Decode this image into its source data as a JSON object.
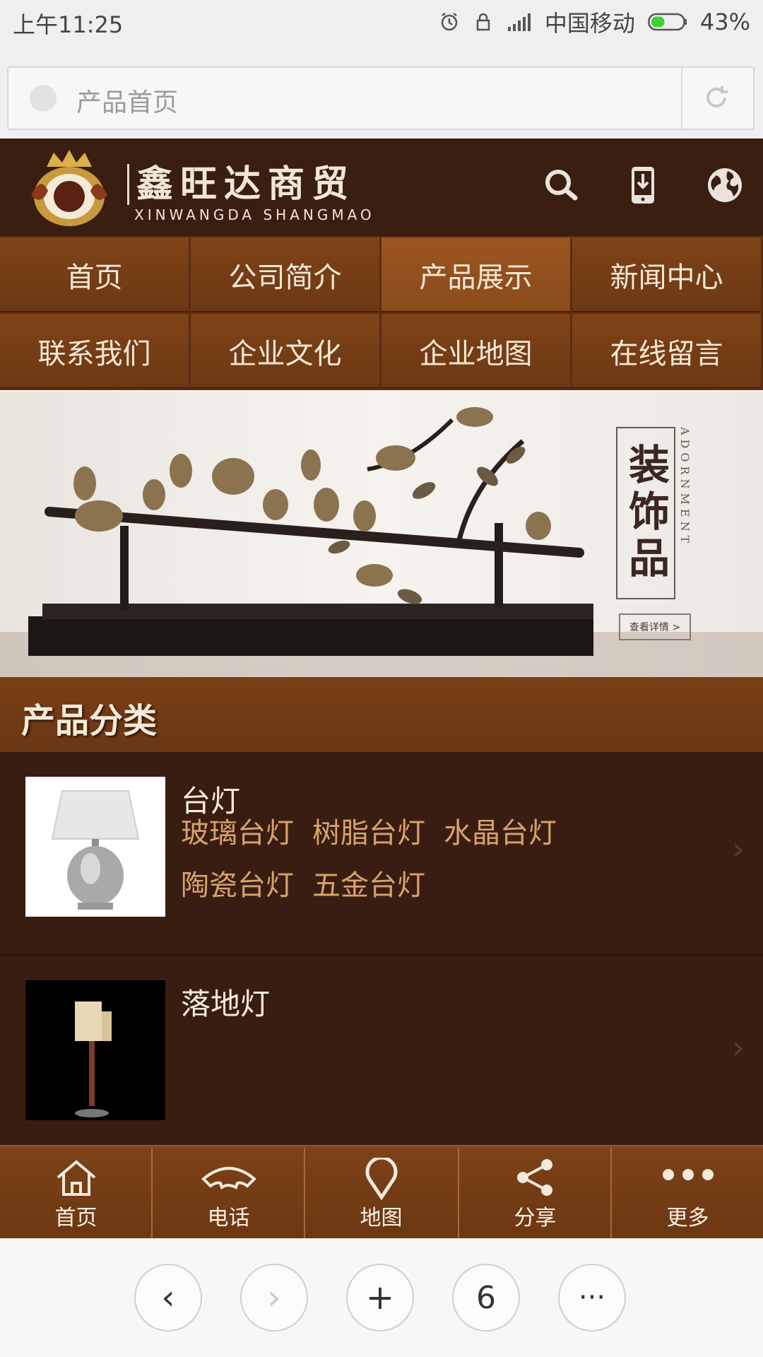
{
  "status_bar": {
    "time": "上午11:25",
    "carrier": "中国移动",
    "battery": "43%",
    "battery_level": 0.43,
    "icons": [
      "alarm-icon",
      "lock-icon",
      "signal-icon",
      "battery-icon"
    ]
  },
  "address_bar": {
    "page_title": "产品首页",
    "icons": [
      "site-globe-icon",
      "reload-icon"
    ]
  },
  "site_header": {
    "brand_cn": "鑫旺达商贸",
    "brand_en": "XINWANGDA SHANGMAO",
    "icons": [
      "search-icon",
      "mobile-download-icon",
      "globe-icon"
    ],
    "colors": {
      "header_bg": "#3a1e12",
      "accent": "#7f4318"
    }
  },
  "nav": {
    "items": [
      {
        "label": "首页"
      },
      {
        "label": "公司简介"
      },
      {
        "label": "产品展示",
        "active": true
      },
      {
        "label": "新闻中心"
      },
      {
        "label": "联系我们"
      },
      {
        "label": "企业文化"
      },
      {
        "label": "企业地图"
      },
      {
        "label": "在线留言"
      }
    ]
  },
  "banner": {
    "title": "装饰品",
    "vertical_en": "ADORNMENT",
    "button": "查看详情 >"
  },
  "category": {
    "heading": "产品分类",
    "items": [
      {
        "name": "台灯",
        "subs": [
          "玻璃台灯",
          "树脂台灯",
          "水晶台灯",
          "陶瓷台灯",
          "五金台灯"
        ],
        "thumb": "table-lamp-image"
      },
      {
        "name": "落地灯",
        "subs": [],
        "thumb": "floor-lamp-image"
      }
    ],
    "chevron": "›"
  },
  "toolbar": {
    "items": [
      {
        "label": "首页",
        "icon": "home-icon"
      },
      {
        "label": "电话",
        "icon": "phone-icon"
      },
      {
        "label": "地图",
        "icon": "map-pin-icon"
      },
      {
        "label": "分享",
        "icon": "share-icon"
      },
      {
        "label": "更多",
        "icon": "more-icon"
      }
    ]
  },
  "browser_nav": {
    "back": "‹",
    "forward": "›",
    "add": "+",
    "tabs_count": "6",
    "menu": "···"
  }
}
